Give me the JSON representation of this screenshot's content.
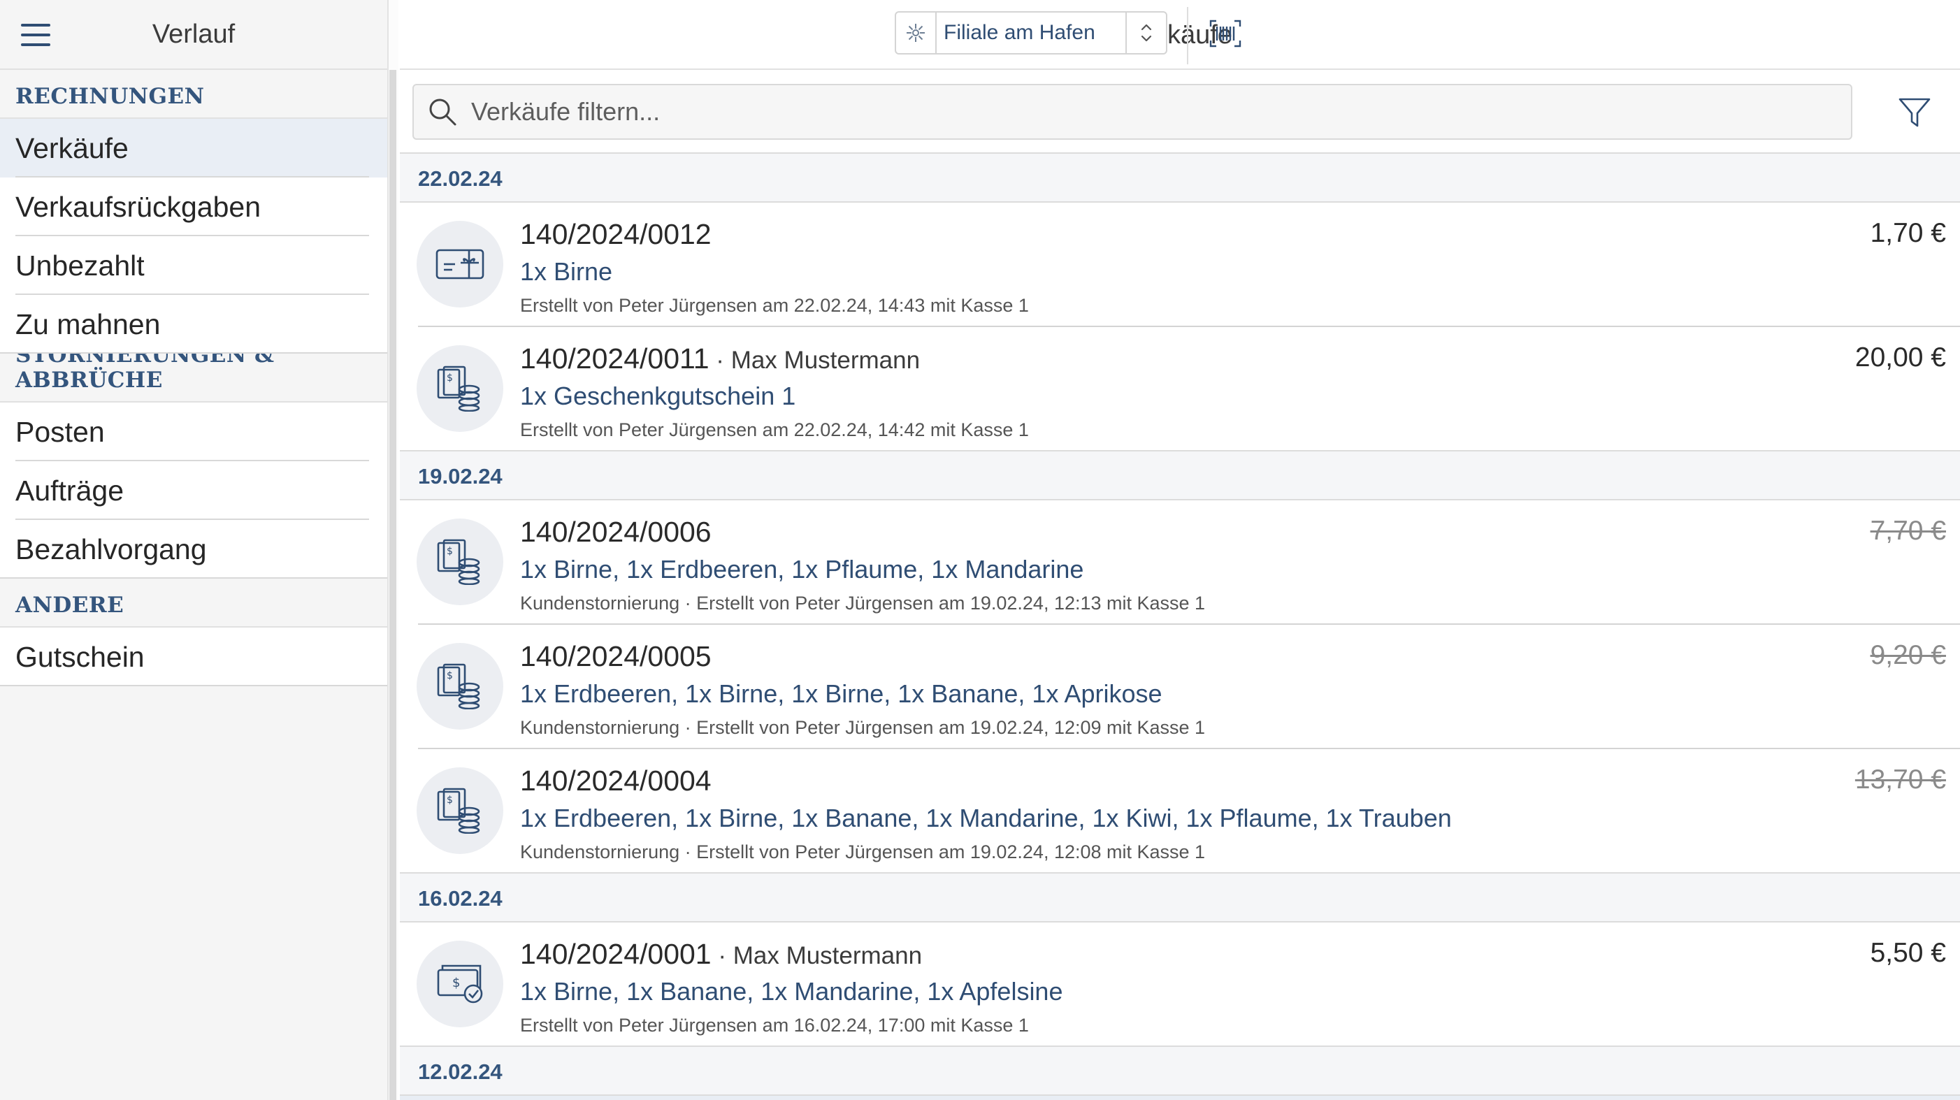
{
  "sidebar": {
    "title": "Verlauf",
    "sections": [
      {
        "heading": "RECHNUNGEN",
        "items": [
          "Verkäufe",
          "Verkaufsrückgaben",
          "Unbezahlt",
          "Zu mahnen"
        ]
      },
      {
        "heading": "STORNIERUNGEN & ABBRÜCHE",
        "items": [
          "Posten",
          "Aufträge",
          "Bezahlvorgang"
        ]
      },
      {
        "heading": "ANDERE",
        "items": [
          "Gutschein"
        ]
      }
    ],
    "active_item": "Verkäufe"
  },
  "header": {
    "title": "Verkäufe",
    "branch": "Filiale am Hafen"
  },
  "search": {
    "placeholder": "Verkäufe filtern..."
  },
  "groups": [
    {
      "date": "22.02.24",
      "sales": [
        {
          "number": "140/2024/0012",
          "customer": "",
          "items": "1x Birne",
          "meta": "Erstellt von Peter Jürgensen am 22.02.24, 14:43 mit Kasse 1",
          "amount": "1,70 €",
          "cancelled": false,
          "icon": "gift-card-icon"
        },
        {
          "number": "140/2024/0011",
          "customer": "Max Mustermann",
          "items": "1x Geschenkgutschein 1",
          "meta": "Erstellt von Peter Jürgensen am 22.02.24, 14:42 mit Kasse 1",
          "amount": "20,00 €",
          "cancelled": false,
          "icon": "cash-coins-icon"
        }
      ]
    },
    {
      "date": "19.02.24",
      "sales": [
        {
          "number": "140/2024/0006",
          "customer": "",
          "items": "1x Birne, 1x Erdbeeren, 1x Pflaume, 1x Mandarine",
          "meta": "Kundenstornierung · Erstellt von Peter Jürgensen am 19.02.24, 12:13 mit Kasse 1",
          "amount": "7,70 €",
          "cancelled": true,
          "icon": "cash-coins-icon"
        },
        {
          "number": "140/2024/0005",
          "customer": "",
          "items": "1x Erdbeeren, 1x Birne, 1x Birne, 1x Banane, 1x Aprikose",
          "meta": "Kundenstornierung · Erstellt von Peter Jürgensen am 19.02.24, 12:09 mit Kasse 1",
          "amount": "9,20 €",
          "cancelled": true,
          "icon": "cash-coins-icon"
        },
        {
          "number": "140/2024/0004",
          "customer": "",
          "items": "1x Erdbeeren, 1x Birne, 1x Banane, 1x Mandarine, 1x Kiwi, 1x Pflaume, 1x Trauben",
          "meta": "Kundenstornierung · Erstellt von Peter Jürgensen am 19.02.24, 12:08 mit Kasse 1",
          "amount": "13,70 €",
          "cancelled": true,
          "icon": "cash-coins-icon"
        }
      ]
    },
    {
      "date": "16.02.24",
      "sales": [
        {
          "number": "140/2024/0001",
          "customer": "Max Mustermann",
          "items": "1x Birne, 1x Banane, 1x Mandarine, 1x Apfelsine",
          "meta": "Erstellt von Peter Jürgensen am 16.02.24, 17:00 mit Kasse 1",
          "amount": "5,50 €",
          "cancelled": false,
          "icon": "cash-check-icon"
        }
      ]
    },
    {
      "date": "12.02.24",
      "sales": []
    }
  ],
  "colors": {
    "accent": "#2f4d73",
    "section_heading": "#34557d",
    "active_item_bg": "#e9eef5"
  }
}
